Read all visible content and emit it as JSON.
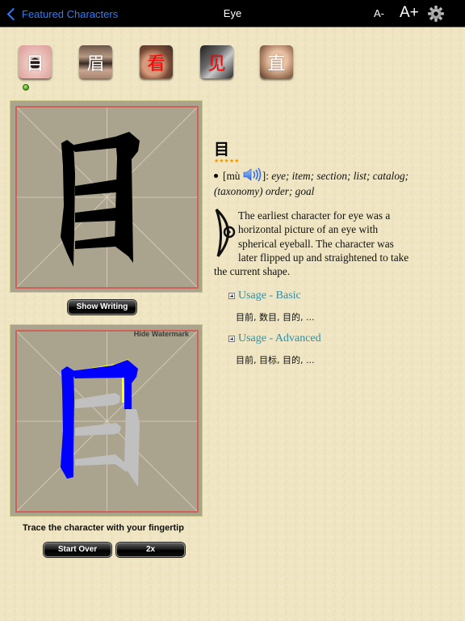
{
  "navbar": {
    "back_label": "Featured Characters",
    "title": "Eye",
    "font_decrease": "A-",
    "font_increase": "A+",
    "settings_icon": "gear-icon",
    "accent_color": "#2f7cf6"
  },
  "thumbnails": [
    {
      "character": "目",
      "active": true
    },
    {
      "character": "眉",
      "active": false
    },
    {
      "character": "看",
      "active": false
    },
    {
      "character": "见",
      "active": false
    },
    {
      "character": "直",
      "active": false
    }
  ],
  "stroke_display": {
    "character": "目",
    "show_writing_label": "Show Writing"
  },
  "tracing": {
    "hide_watermark_label": "Hide Watermark",
    "instruction": "Trace the character with your fingertip",
    "start_over_label": "Start Over",
    "speed_label": "2x",
    "traced_color": "#0000ff",
    "highlight_color": "#ffff00",
    "remaining_color": "#c0c0c0"
  },
  "entry": {
    "character": "目",
    "rating_stars": "★★★★★",
    "rating": 5,
    "pinyin": "mù",
    "speaker_icon": "speaker-icon",
    "meanings": "eye; item; section; list; catalog; (taxonomy) order; goal",
    "etymology": "The earliest character for eye was a horizontal picture of an eye with spherical eyeball. The character was later flipped up and straightened to take the current shape.",
    "usage_basic": {
      "label": "Usage - Basic",
      "words": "目前, 数目, 目的, ..."
    },
    "usage_advanced": {
      "label": "Usage - Advanced",
      "words": "目前, 目标, 目的, ..."
    }
  }
}
